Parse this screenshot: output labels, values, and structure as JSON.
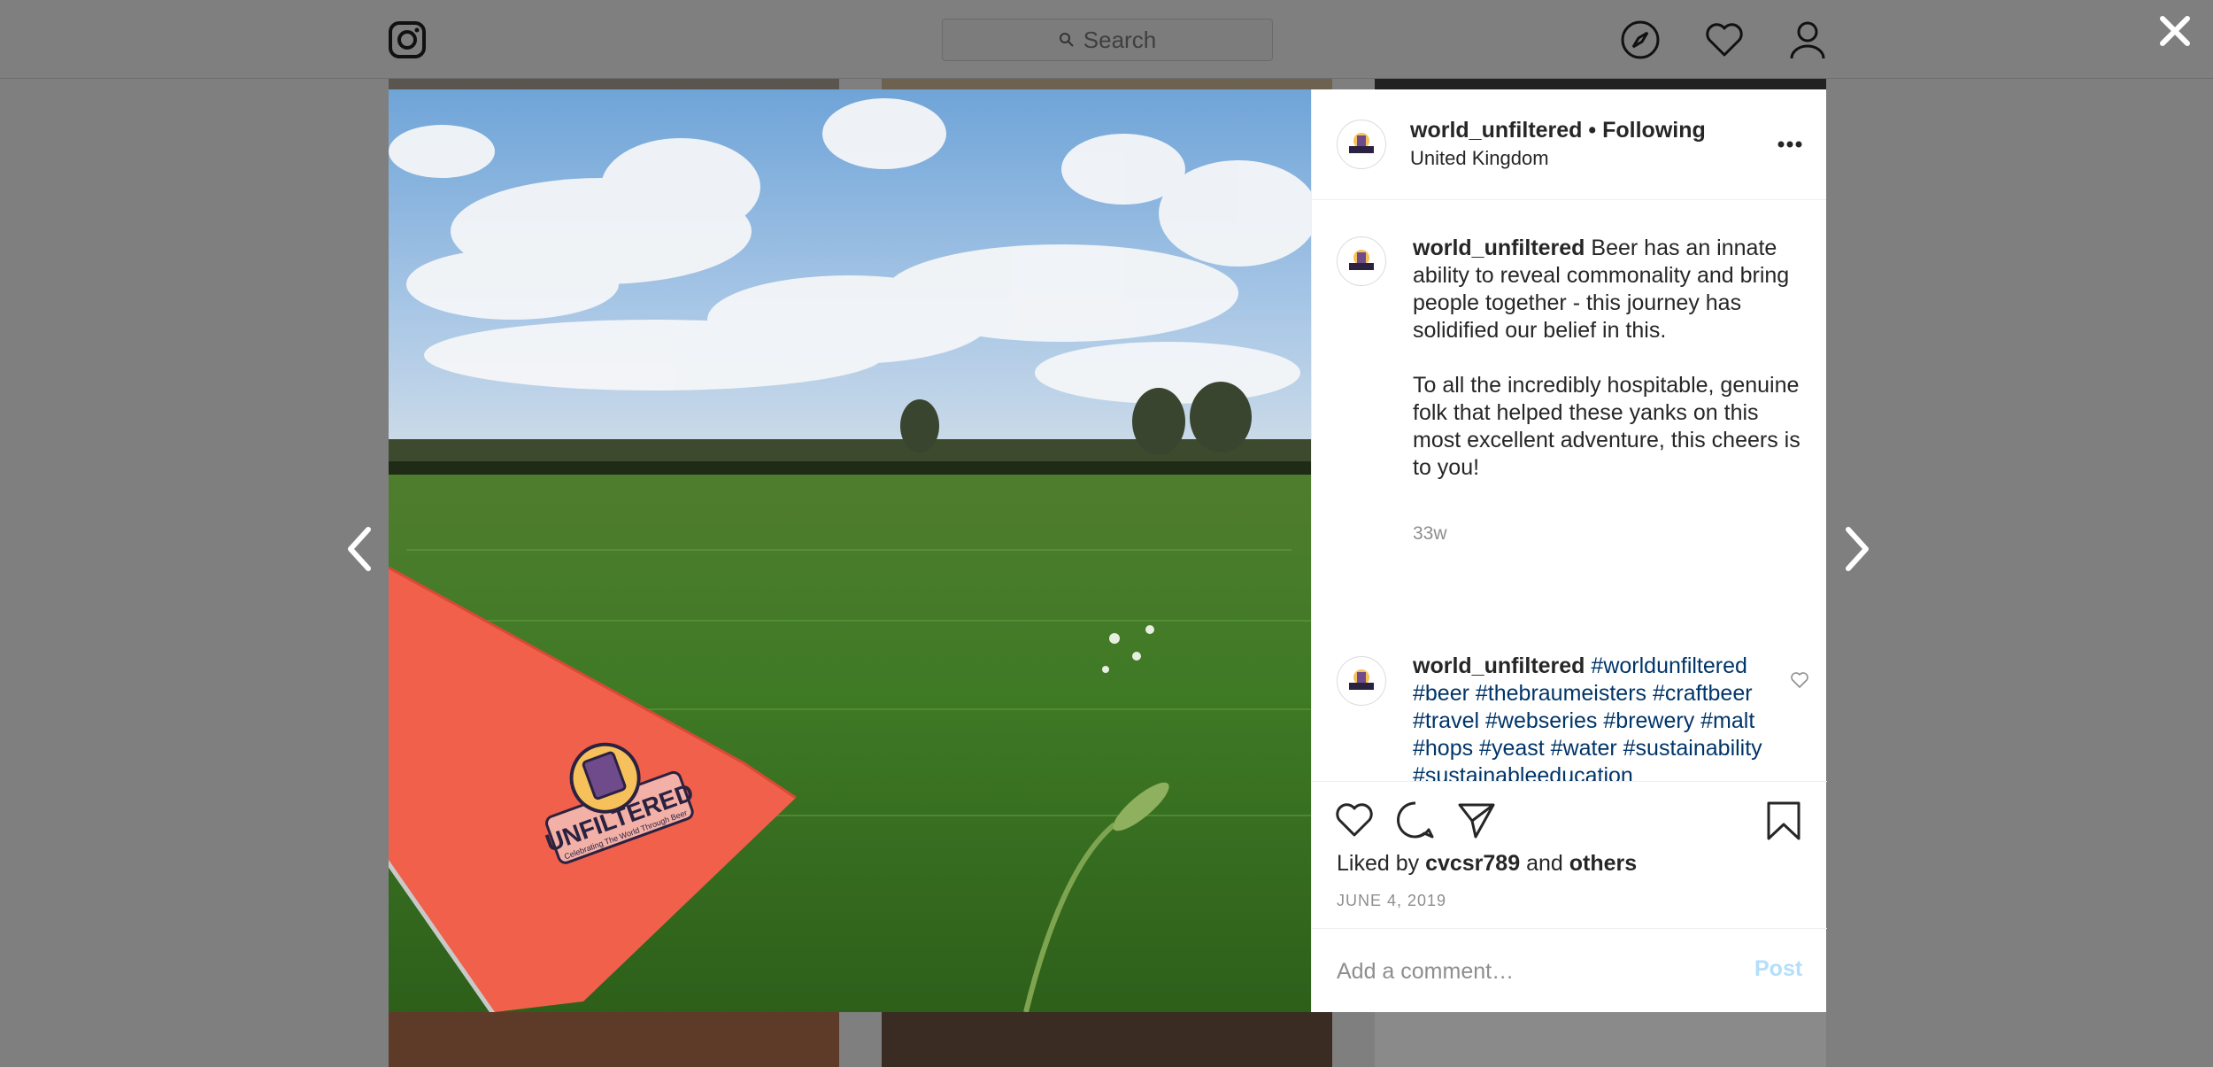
{
  "topbar": {
    "logo_icon": "instagram-icon",
    "search_placeholder": "Search",
    "nav_icons": [
      "compass-icon",
      "heart-icon",
      "profile-icon"
    ]
  },
  "post": {
    "username": "world_unfiltered",
    "separator": " • ",
    "follow_status": "Following",
    "location": "United Kingdom",
    "caption_part1": "Beer has an innate ability to reveal commonality and bring people together - this journey has solidified our belief in this.",
    "caption_part2": "To all the incredibly hospitable, genuine folk that helped these yanks on this most excellent adventure, this cheers is to you!",
    "caption_time": "33w",
    "hashtags": "#worldunfiltered #beer #thebraumeisters #craftbeer #travel #webseries #brewery #malt #hops #yeast #water #sustainability #sustainableeducation #sustainablebrewing #infinitempg #milesperbeer #pedalandpints",
    "liked_by_prefix": "Liked by ",
    "liked_by_user": "cvcsr789",
    "liked_by_and": " and ",
    "liked_by_others": "others",
    "date": "JUNE 4, 2019",
    "comment_placeholder": "Add a comment…",
    "post_label": "Post",
    "flag_text": "UNFILTERED",
    "flag_subtext": "Celebrating The World Through Beer"
  },
  "colors": {
    "overlay": "#7f7f7f",
    "hashtag": "#003569",
    "post_button_disabled": "#b2dffc",
    "muted": "#8e8e8e",
    "flag": "#f0604a"
  }
}
